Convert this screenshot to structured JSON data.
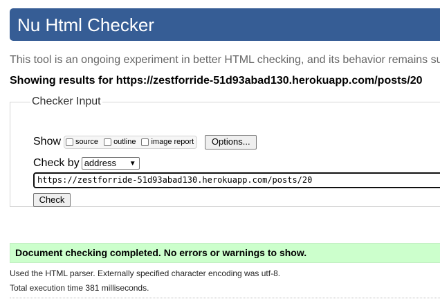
{
  "header": {
    "title": "Nu Html Checker"
  },
  "intro": {
    "text": "This tool is an ongoing experiment in better HTML checking, and its behavior remains su"
  },
  "showing": {
    "text": "Showing results for https://zestforride-51d93abad130.herokuapp.com/posts/20"
  },
  "checker_input": {
    "legend": "Checker Input",
    "show_label": "Show",
    "options": [
      {
        "label": "source",
        "checked": false
      },
      {
        "label": "outline",
        "checked": false
      },
      {
        "label": "image report",
        "checked": false
      }
    ],
    "options_button": "Options...",
    "check_by_label": "Check by",
    "check_by_value": "address",
    "url_value": "https://zestforride-51d93abad130.herokuapp.com/posts/20",
    "check_button": "Check"
  },
  "results": {
    "success_message": "Document checking completed. No errors or warnings to show.",
    "parser_info": "Used the HTML parser. Externally specified character encoding was utf-8.",
    "timing": "Total execution time 381 milliseconds."
  },
  "colors": {
    "header_bg": "#365d95",
    "success_bg": "#ccffcc"
  }
}
